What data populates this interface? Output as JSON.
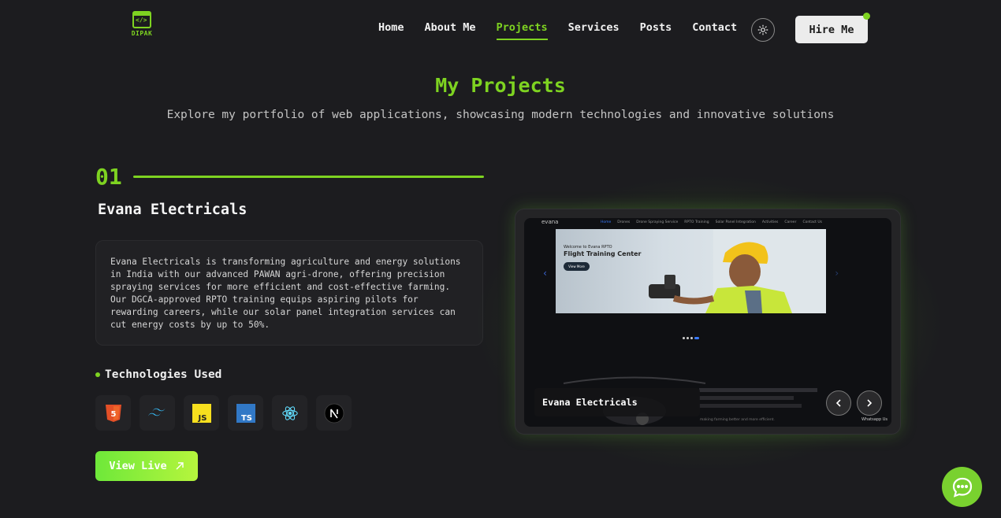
{
  "header": {
    "logo_text": "DIPAK",
    "logo_glyph": "</>",
    "nav_items": [
      {
        "label": "Home",
        "active": false
      },
      {
        "label": "About Me",
        "active": false
      },
      {
        "label": "Projects",
        "active": true
      },
      {
        "label": "Services",
        "active": false
      },
      {
        "label": "Posts",
        "active": false
      },
      {
        "label": "Contact",
        "active": false
      }
    ],
    "theme_icon": "sun-icon",
    "hire_label": "Hire Me"
  },
  "hero": {
    "title": "My Projects",
    "subtitle": "Explore my portfolio of web applications, showcasing modern technologies and innovative solutions"
  },
  "project": {
    "number": "01",
    "name": "Evana Electricals",
    "description": "Evana Electricals is transforming agriculture and energy solutions in India with our advanced PAWAN agri-drone, offering precision spraying services for more efficient and cost-effective farming. Our DGCA-approved RPTO training equips aspiring pilots for rewarding careers, while our solar panel integration services can cut energy costs by up to 50%.",
    "technologies_heading": "Technologies Used",
    "technologies": [
      {
        "name": "html5-icon",
        "color": "#e34f26"
      },
      {
        "name": "tailwind-icon",
        "color": "#38bdf8"
      },
      {
        "name": "javascript-icon",
        "color": "#f7df1e"
      },
      {
        "name": "typescript-icon",
        "color": "#3178c6"
      },
      {
        "name": "react-icon",
        "color": "#61dafb"
      },
      {
        "name": "nextjs-icon",
        "color": "#000000"
      }
    ],
    "view_live_label": "View Live",
    "preview": {
      "caption": "Evana Electricals",
      "site_logo": "evana",
      "site_nav": [
        "Home",
        "Drones",
        "Drone Spraying Service",
        "RPTO Training",
        "Solar Panel Integration",
        "Activities",
        "Career",
        "Contact Us"
      ],
      "banner_small": "Welcome to Evana RPTO",
      "banner_title": "Flight Training Center",
      "banner_button": "View More",
      "footer_text": "making farming better and more efficient.",
      "whatsapp_label": "Whatsapp Us"
    }
  },
  "colors": {
    "accent": "#7ed321",
    "background": "#1c1c1f"
  }
}
